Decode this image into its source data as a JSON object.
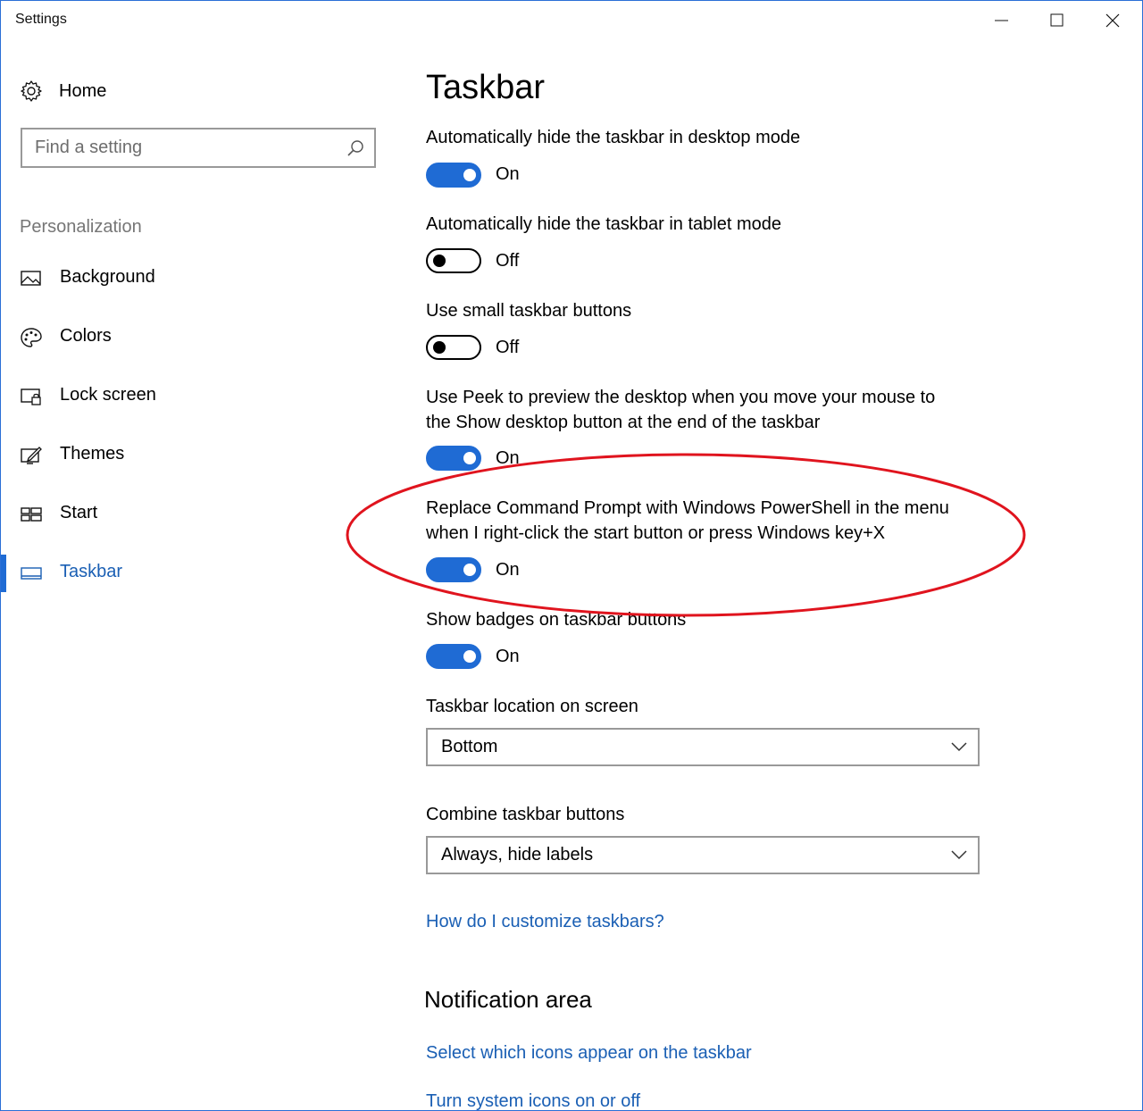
{
  "window": {
    "title": "Settings",
    "controls": {
      "minimize": "minimize-icon",
      "maximize": "maximize-icon",
      "close": "close-icon"
    },
    "border_color": "#2b6fd6"
  },
  "sidebar": {
    "home_label": "Home",
    "search_placeholder": "Find a setting",
    "section_label": "Personalization",
    "items": [
      {
        "label": "Background",
        "icon": "picture-icon",
        "active": false
      },
      {
        "label": "Colors",
        "icon": "palette-icon",
        "active": false
      },
      {
        "label": "Lock screen",
        "icon": "lock-screen-icon",
        "active": false
      },
      {
        "label": "Themes",
        "icon": "themes-icon",
        "active": false
      },
      {
        "label": "Start",
        "icon": "start-icon",
        "active": false
      },
      {
        "label": "Taskbar",
        "icon": "taskbar-icon",
        "active": true
      }
    ]
  },
  "main": {
    "title": "Taskbar",
    "settings": [
      {
        "label": "Automatically hide the taskbar in desktop mode",
        "state": "On",
        "on": true
      },
      {
        "label": "Automatically hide the taskbar in tablet mode",
        "state": "Off",
        "on": false
      },
      {
        "label": "Use small taskbar buttons",
        "state": "Off",
        "on": false
      },
      {
        "label": "Use Peek to preview the desktop when you move your mouse to the Show desktop button at the end of the taskbar",
        "state": "On",
        "on": true
      },
      {
        "label": "Replace Command Prompt with Windows PowerShell in the menu when I right-click the start button or press Windows key+X",
        "state": "On",
        "on": true
      },
      {
        "label": "Show badges on taskbar buttons",
        "state": "On",
        "on": true
      }
    ],
    "location": {
      "label": "Taskbar location on screen",
      "value": "Bottom"
    },
    "combine": {
      "label": "Combine taskbar buttons",
      "value": "Always, hide labels"
    },
    "help_link": "How do I customize taskbars?",
    "notification": {
      "heading": "Notification area",
      "links": [
        "Select which icons appear on the taskbar",
        "Turn system icons on or off"
      ]
    }
  },
  "colors": {
    "accent": "#1f6bd4",
    "link": "#1a5fb4",
    "annotation": "#e0141e",
    "muted_text": "#767676"
  }
}
